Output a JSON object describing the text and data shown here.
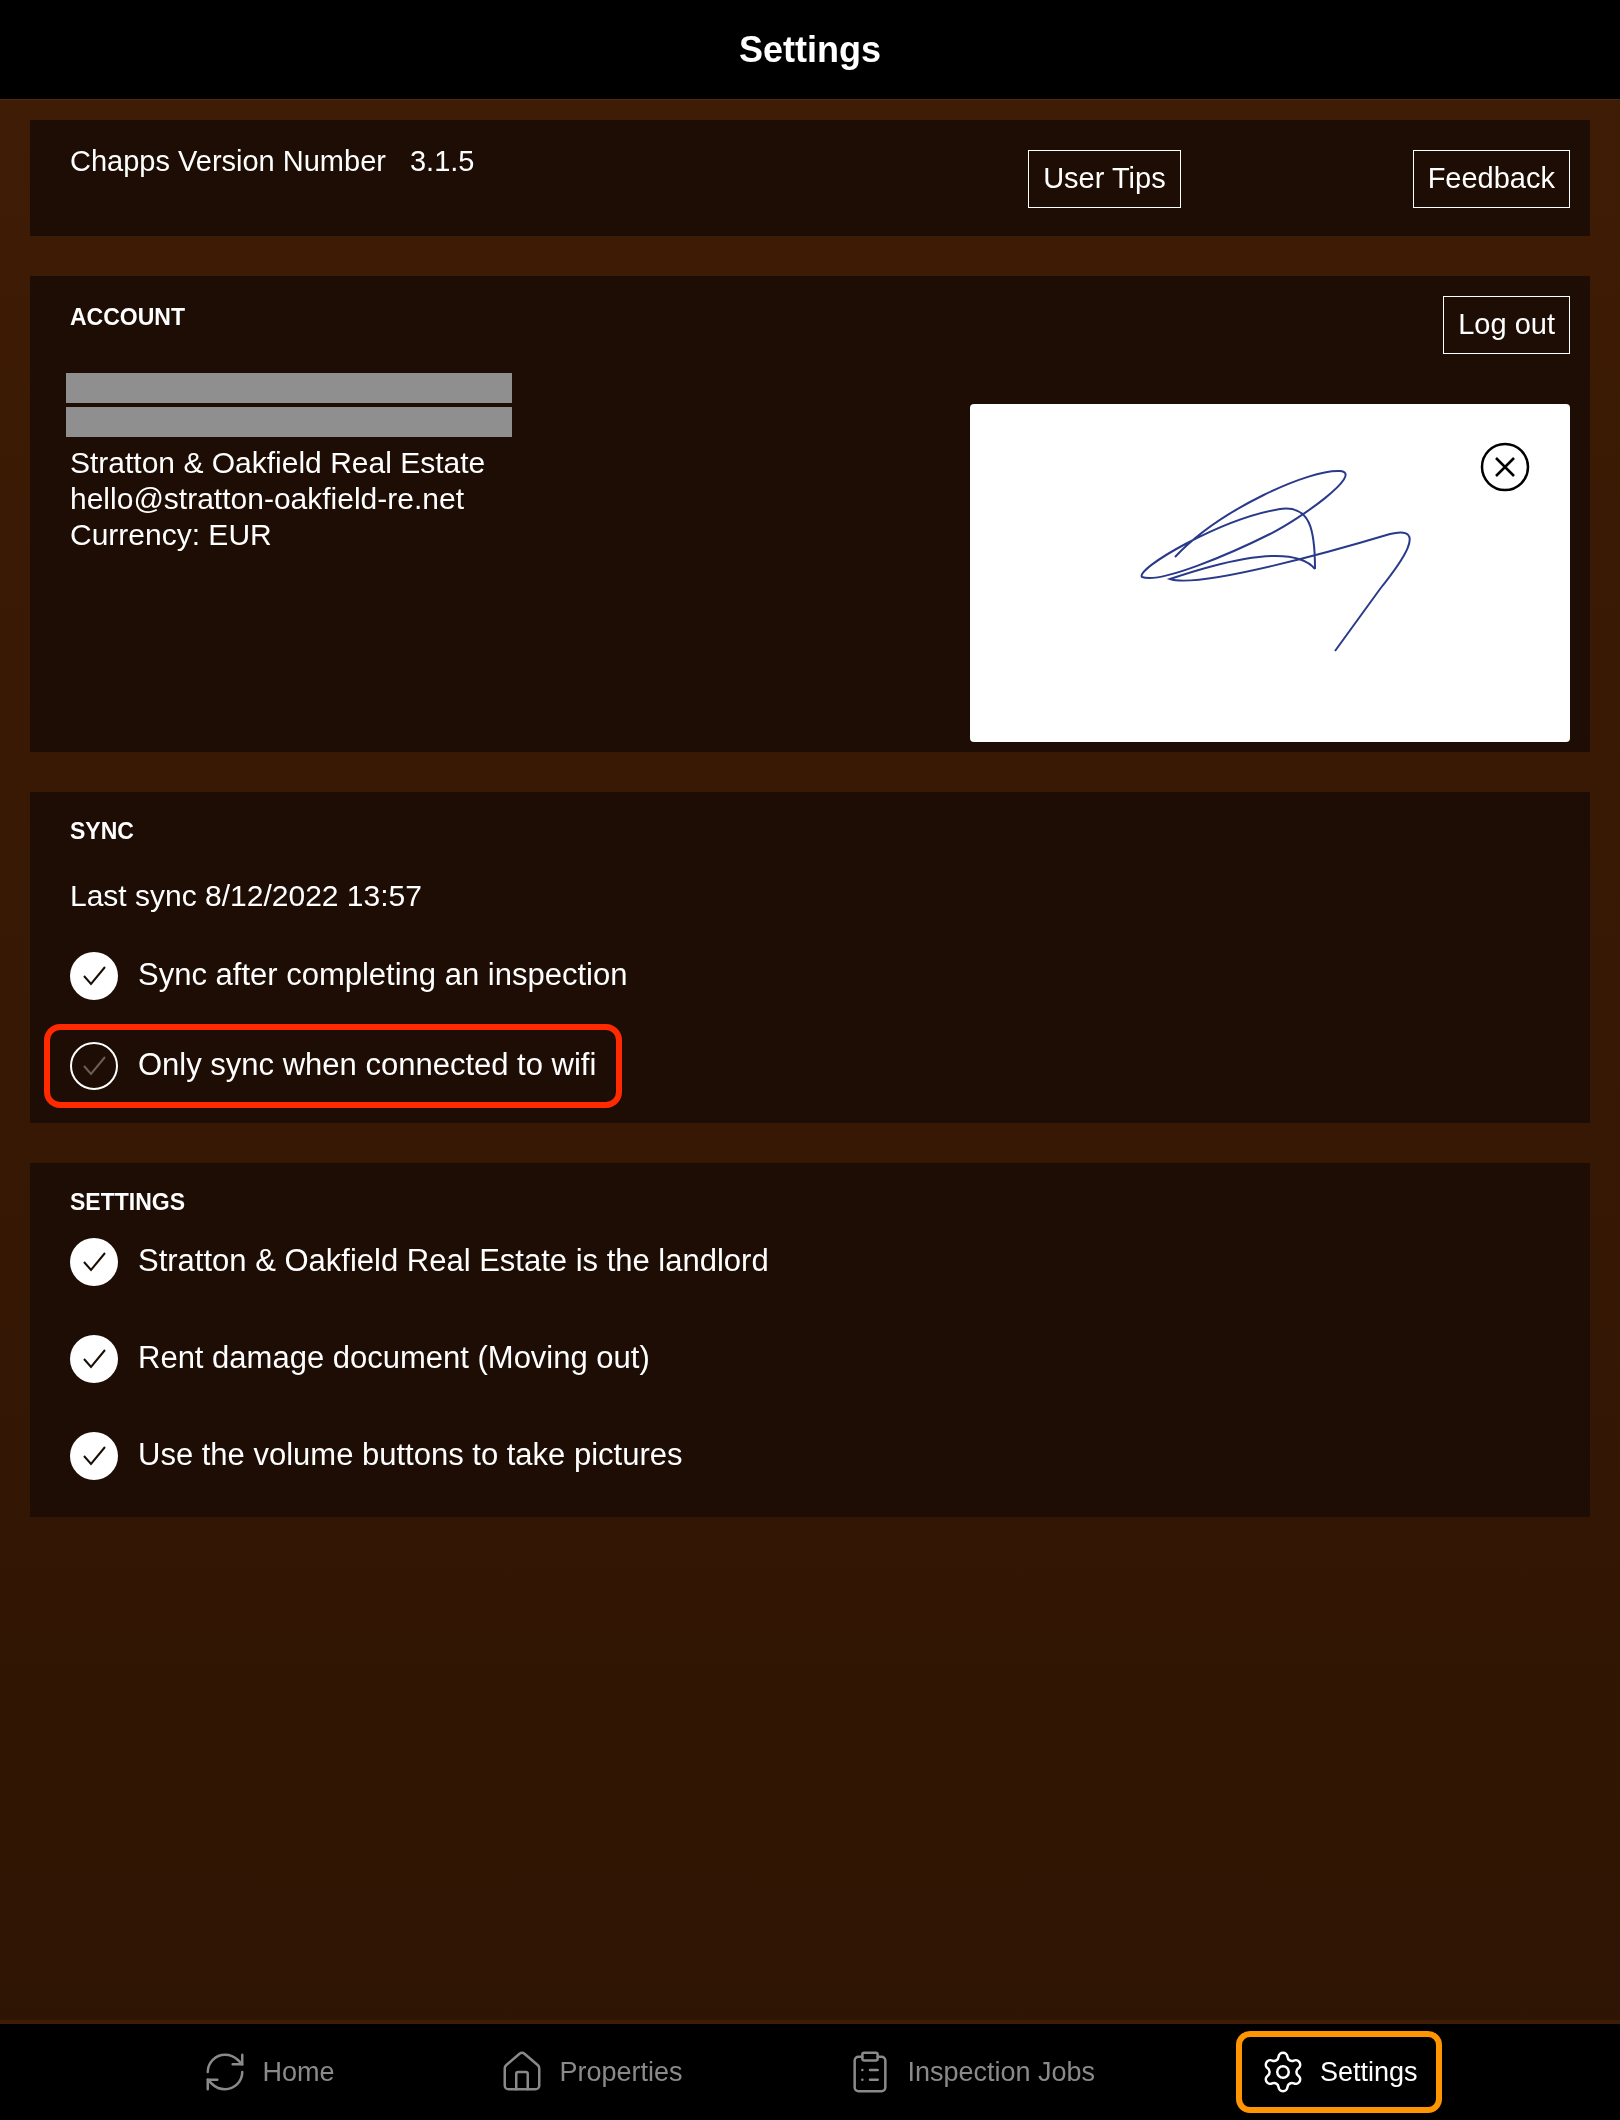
{
  "header": {
    "title": "Settings"
  },
  "version": {
    "label": "Chapps Version Number",
    "value": "3.1.5",
    "buttons": [
      "User Tips",
      "Feedback"
    ]
  },
  "account": {
    "heading": "ACCOUNT",
    "logout": "Log out",
    "lines": [
      "Stratton & Oakfield Real Estate",
      "hello@stratton-oakfield-re.net",
      "Currency: EUR"
    ]
  },
  "sync": {
    "heading": "SYNC",
    "last_sync": "Last sync 8/12/2022 13:57",
    "options": [
      {
        "label": "Sync after completing an inspection",
        "checked": true,
        "highlighted": false
      },
      {
        "label": "Only sync when connected to wifi",
        "checked": false,
        "highlighted": true
      }
    ]
  },
  "settings": {
    "heading": "SETTINGS",
    "options": [
      {
        "label": "Stratton & Oakfield Real Estate is the landlord",
        "checked": true
      },
      {
        "label": "Rent damage document (Moving out)",
        "checked": true
      },
      {
        "label": "Use the volume buttons to take pictures",
        "checked": true
      }
    ]
  },
  "tab_bar": [
    {
      "label": "Home",
      "kind": "sync",
      "selected": false
    },
    {
      "label": "Properties",
      "kind": "house",
      "selected": false
    },
    {
      "label": "Inspection Jobs",
      "kind": "clipboard",
      "selected": false
    },
    {
      "label": "Settings",
      "kind": "gear",
      "selected": true
    }
  ]
}
